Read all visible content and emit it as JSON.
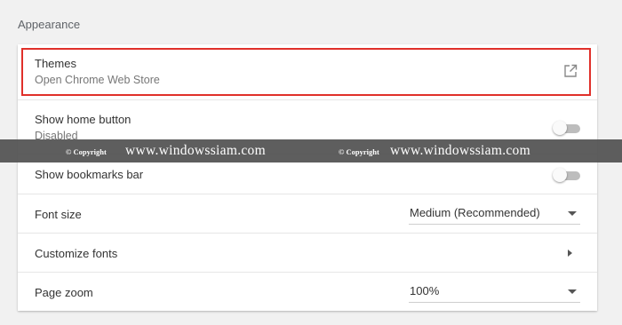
{
  "section": {
    "title": "Appearance"
  },
  "themes": {
    "label": "Themes",
    "sublabel": "Open Chrome Web Store",
    "icon": "external-link-icon"
  },
  "home_button": {
    "label": "Show home button",
    "sublabel": "Disabled",
    "enabled": false
  },
  "bookmarks_bar": {
    "label": "Show bookmarks bar",
    "enabled": false
  },
  "font_size": {
    "label": "Font size",
    "value": "Medium (Recommended)"
  },
  "customize_fonts": {
    "label": "Customize fonts",
    "icon": "arrow-right-icon"
  },
  "page_zoom": {
    "label": "Page zoom",
    "value": "100%"
  },
  "watermark": {
    "copyright_1": "© Copyright",
    "site_1": "www.windowssiam.com",
    "copyright_2": "© Copyright",
    "site_2": "www.windowssiam.com"
  },
  "colors": {
    "highlight": "#e0302a",
    "watermark_bar": "#505050",
    "background": "#f1f1f1"
  }
}
